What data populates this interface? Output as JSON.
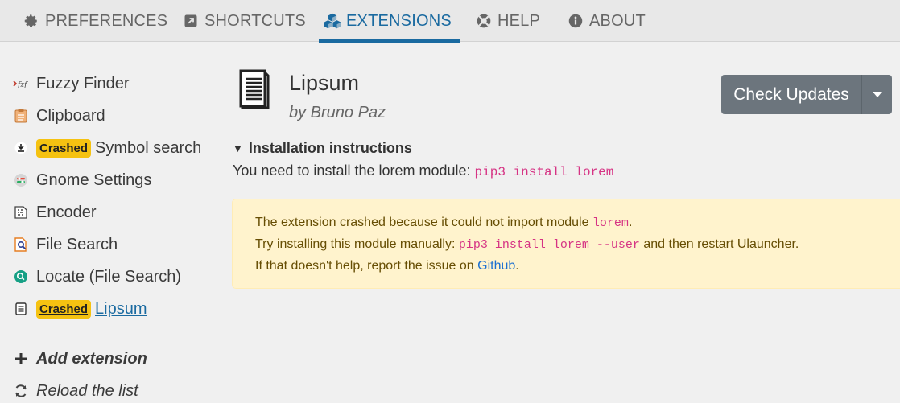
{
  "tabs": [
    {
      "label": "PREFERENCES",
      "icon": "gear-icon"
    },
    {
      "label": "SHORTCUTS",
      "icon": "external-link-icon"
    },
    {
      "label": "EXTENSIONS",
      "icon": "cubes-icon"
    },
    {
      "label": "HELP",
      "icon": "lifebuoy-icon"
    },
    {
      "label": "ABOUT",
      "icon": "info-circle-icon"
    }
  ],
  "active_tab": "EXTENSIONS",
  "sidebar": {
    "extensions": [
      {
        "label": "Fuzzy Finder",
        "icon": "fzf-icon",
        "badge": ""
      },
      {
        "label": "Clipboard",
        "icon": "clipboard-icon",
        "badge": ""
      },
      {
        "label": "Symbol search",
        "icon": "symbol-icon",
        "badge": "Crashed"
      },
      {
        "label": "Gnome Settings",
        "icon": "gnome-settings-icon",
        "badge": ""
      },
      {
        "label": "Encoder",
        "icon": "encoder-icon",
        "badge": ""
      },
      {
        "label": "File Search",
        "icon": "file-search-icon",
        "badge": ""
      },
      {
        "label": "Locate (File Search)",
        "icon": "locate-icon",
        "badge": ""
      },
      {
        "label": "Lipsum",
        "icon": "lipsum-icon",
        "badge": "Crashed"
      }
    ],
    "add_extension": "Add extension",
    "reload_list": "Reload the list"
  },
  "extension": {
    "title": "Lipsum",
    "author": "by Bruno Paz",
    "check_updates": "Check Updates",
    "instructions_heading": "Installation instructions",
    "instructions_text": "You need to install the lorem module:",
    "instructions_code": "pip3 install lorem",
    "alert": {
      "line1_text": "The extension crashed because it could not import module",
      "line1_code": "lorem",
      "line1_end": ".",
      "line2_text": "Try installing this module manually:",
      "line2_code": "pip3 install lorem --user",
      "line2_end": "and then restart Ulauncher.",
      "line3_text": "If that doesn't help, report the issue on",
      "line3_link": "Github",
      "line3_end": "."
    }
  },
  "colors": {
    "accent": "#1a6aa0",
    "badge": "#f5c211",
    "button": "#6c757d",
    "alert_bg": "#fff3cd",
    "code": "#d63384"
  }
}
